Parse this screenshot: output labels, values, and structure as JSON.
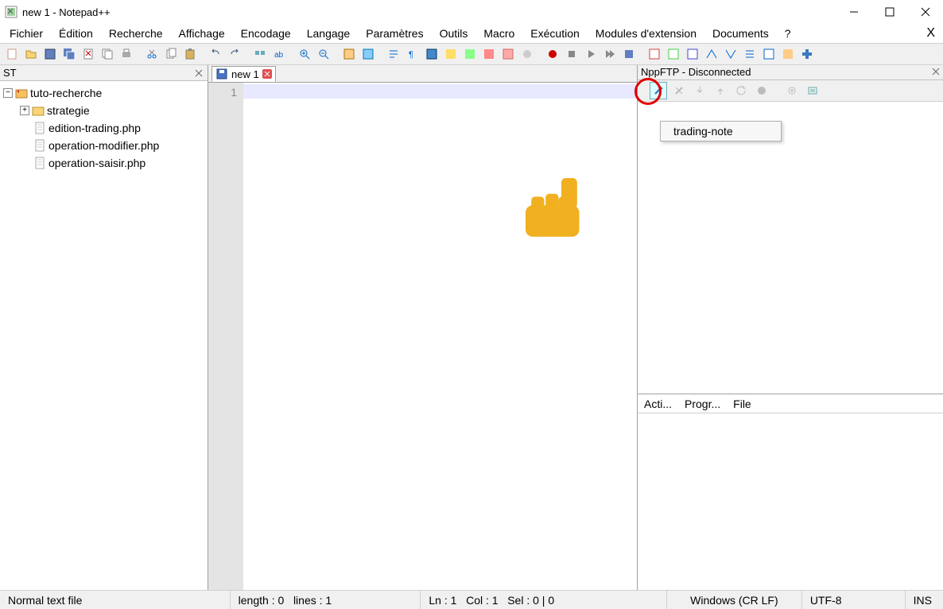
{
  "window": {
    "title": "new 1 - Notepad++"
  },
  "menu": [
    "Fichier",
    "Édition",
    "Recherche",
    "Affichage",
    "Encodage",
    "Langage",
    "Paramètres",
    "Outils",
    "Macro",
    "Exécution",
    "Modules d'extension",
    "Documents",
    "?"
  ],
  "sidebar": {
    "title": "ST",
    "root": {
      "label": "tuto-recherche",
      "children": [
        {
          "label": "strategie",
          "type": "folder"
        },
        {
          "label": "edition-trading.php",
          "type": "file"
        },
        {
          "label": "operation-modifier.php",
          "type": "file"
        },
        {
          "label": "operation-saisir.php",
          "type": "file"
        }
      ]
    }
  },
  "editor": {
    "tab_label": "new 1",
    "line_number": "1"
  },
  "ftp": {
    "title": "NppFTP - Disconnected",
    "dropdown_item": "trading-note",
    "bottom_tabs": [
      "Acti...",
      "Progr...",
      "File"
    ]
  },
  "status": {
    "filetype": "Normal text file",
    "length": "length : 0",
    "lines": "lines : 1",
    "ln": "Ln : 1",
    "col": "Col : 1",
    "sel": "Sel : 0 | 0",
    "eol": "Windows (CR LF)",
    "encoding": "UTF-8",
    "ins": "INS"
  }
}
